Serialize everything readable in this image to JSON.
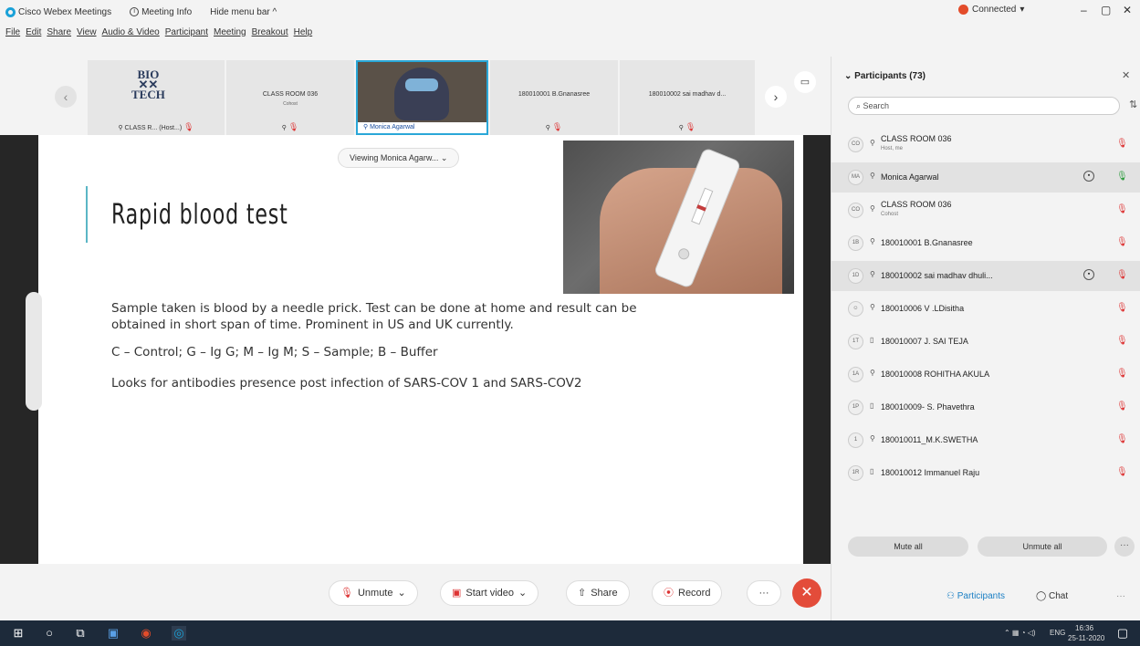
{
  "titlebar": {
    "app_name": "Cisco Webex Meetings",
    "meeting_info": "Meeting Info",
    "hide_menu": "Hide menu bar ^",
    "connection_status": "Connected",
    "minimize": "–",
    "restore": "▢",
    "close": "✕"
  },
  "menu": [
    "File",
    "Edit",
    "Share",
    "View",
    "Audio & Video",
    "Participant",
    "Meeting",
    "Breakout",
    "Help"
  ],
  "strip": {
    "tiles": [
      {
        "name": "CLASS R... (Host...)",
        "logo": "BIO\nTECH"
      },
      {
        "name": "CLASS ROOM 036",
        "sub": "Cohost"
      },
      {
        "name": "Monica Agarwal"
      },
      {
        "name": "180010001 B.Gnanasree"
      },
      {
        "name": "180010002 sai madhav d..."
      }
    ],
    "prev": "‹",
    "next": "›",
    "layout_icon": "▭"
  },
  "share": {
    "viewing_label": "Viewing Monica Agarw...",
    "slide_title": "Rapid blood test",
    "lines": [
      "Sample taken is blood by a needle prick. Test can be done at home and result can be",
      "obtained in short span of time. Prominent in US and UK currently.",
      "C – Control; G – Ig G; M – Ig M; S – Sample; B – Buffer",
      "Looks for antibodies presence post infection of SARS-COV 1 and SARS-COV2"
    ]
  },
  "controls": {
    "unmute": "Unmute",
    "start_video": "Start video",
    "share": "Share",
    "record": "Record",
    "more": "···",
    "leave": "✕"
  },
  "panel": {
    "title": "Participants (73)",
    "search_placeholder": "Search",
    "participants": [
      {
        "initials": "CO",
        "name": "CLASS ROOM 036",
        "sub": "Host, me",
        "mic": "muted"
      },
      {
        "initials": "MA",
        "name": "Monica Agarwal",
        "sub": "",
        "mic": "active",
        "video": true
      },
      {
        "initials": "CO",
        "name": "CLASS ROOM 036",
        "sub": "Cohost",
        "mic": "muted"
      },
      {
        "initials": "1B",
        "name": "180010001 B.Gnanasree",
        "sub": "",
        "mic": "muted"
      },
      {
        "initials": "1D",
        "name": "180010002 sai madhav dhuli...",
        "sub": "",
        "mic": "muted",
        "video": true
      },
      {
        "initials": "",
        "name": "180010006 V .LDisitha",
        "sub": "",
        "mic": "muted"
      },
      {
        "initials": "1T",
        "name": "180010007 J. SAI TEJA",
        "sub": "",
        "mic": "muted"
      },
      {
        "initials": "1A",
        "name": "180010008 ROHITHA AKULA",
        "sub": "",
        "mic": "muted"
      },
      {
        "initials": "1P",
        "name": "180010009- S. Phavethra",
        "sub": "",
        "mic": "muted"
      },
      {
        "initials": "1",
        "name": "180010011_M.K.SWETHA",
        "sub": "",
        "mic": "muted"
      },
      {
        "initials": "1R",
        "name": "180010012 Immanuel Raju",
        "sub": "",
        "mic": "muted"
      }
    ],
    "mute_all": "Mute all",
    "unmute_all": "Unmute all",
    "more": "···",
    "tab_participants": "Participants",
    "tab_chat": "Chat"
  },
  "taskbar": {
    "tray_lang": "ENG",
    "time": "16:36",
    "date": "25-11-2020"
  },
  "colors": {
    "accent": "#1aa1d8",
    "leave": "#e34c3a",
    "muted": "#dd3333",
    "active_mic": "#2a9a3a",
    "slide_bar": "#5bb6c6"
  }
}
